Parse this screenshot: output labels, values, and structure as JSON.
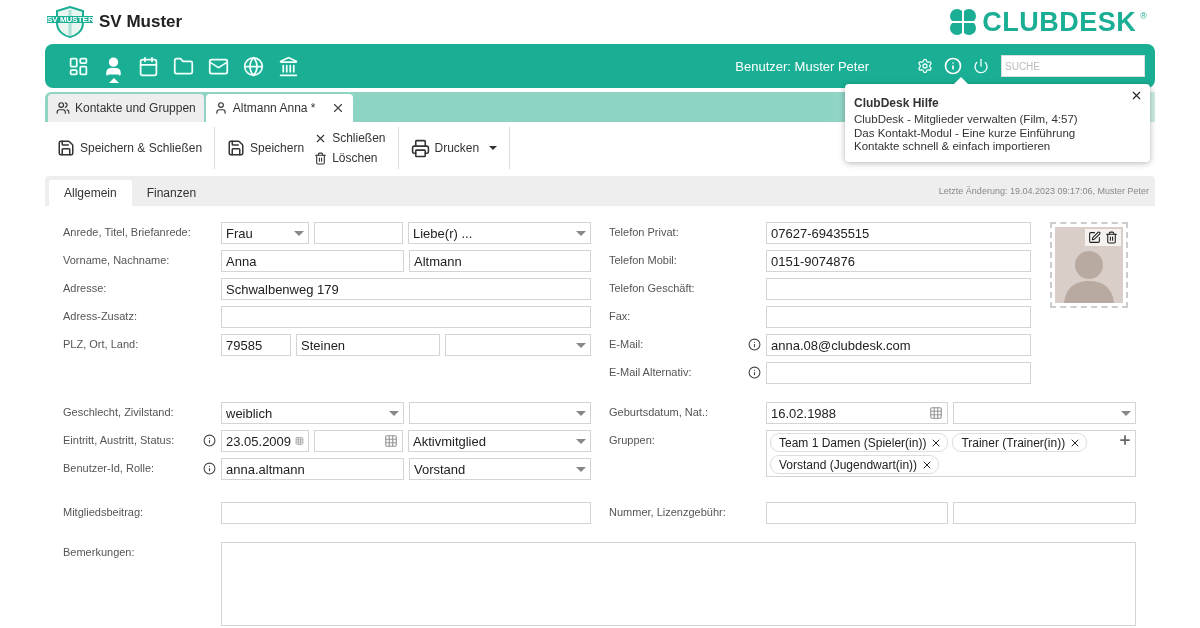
{
  "header": {
    "club_name": "SV Muster",
    "club_badge": "SV MUSTER",
    "brand": "CLUBDESK",
    "brand_mark": "®"
  },
  "nav": {
    "items": [
      {
        "kind": "dashboard",
        "selected": false
      },
      {
        "kind": "person",
        "selected": true
      },
      {
        "kind": "calendar",
        "selected": false
      },
      {
        "kind": "folder",
        "selected": false
      },
      {
        "kind": "mail",
        "selected": false
      },
      {
        "kind": "globe",
        "selected": false
      },
      {
        "kind": "bank",
        "selected": false
      }
    ],
    "user": "Benutzer: Muster Peter",
    "tools": [
      {
        "kind": "settings",
        "selected": false
      },
      {
        "kind": "info",
        "selected": true
      },
      {
        "kind": "power",
        "selected": false
      }
    ],
    "search": {
      "placeholder": "SUCHE"
    }
  },
  "doc_tabs": [
    {
      "kind": "group",
      "label": "Kontakte und Gruppen",
      "selected": false,
      "closable": false
    },
    {
      "kind": "person",
      "label": "Altmann Anna *",
      "selected": true,
      "closable": true
    }
  ],
  "toolbar": [
    {
      "buttons": [
        {
          "kind": "save",
          "label": "Speichern & Schließen"
        }
      ]
    },
    {
      "buttons": [
        {
          "kind": "save",
          "label": "Speichern"
        }
      ],
      "stack": [
        {
          "kind": "close",
          "label": "Schließen"
        },
        {
          "kind": "trash",
          "label": "Löschen"
        }
      ]
    },
    {
      "buttons": [
        {
          "kind": "print",
          "label": "Drucken",
          "dropdown": true
        }
      ]
    }
  ],
  "form_tabs": [
    {
      "label": "Allgemein",
      "selected": true
    },
    {
      "label": "Finanzen",
      "selected": false
    }
  ],
  "last_change": "Letzte Änderung: 19.04.2023 09:17:06, Muster Peter",
  "form": {
    "contact": {
      "left": [
        {
          "label": "Anrede, Titel, Briefanrede:",
          "info": false,
          "fields": [
            {
              "kind": "select",
              "value": "Frau"
            },
            {
              "kind": "text"
            },
            {
              "kind": "select",
              "value": "Liebe(r) ..."
            }
          ]
        },
        {
          "label": "Vorname, Nachname:",
          "info": false,
          "fields": [
            {
              "kind": "text",
              "value": "Anna"
            },
            {
              "kind": "text",
              "value": "Altmann"
            }
          ]
        },
        {
          "label": "Adresse:",
          "info": false,
          "fields": [
            {
              "kind": "text",
              "value": "Schwalbenweg 179"
            }
          ]
        },
        {
          "label": "Adress-Zusatz:",
          "info": false,
          "fields": [
            {
              "kind": "text"
            }
          ]
        },
        {
          "label": "PLZ, Ort, Land:",
          "info": false,
          "fields": [
            {
              "kind": "text",
              "value": "79585"
            },
            {
              "kind": "text",
              "value": "Steinen"
            },
            {
              "kind": "select"
            }
          ]
        }
      ],
      "right": [
        {
          "label": "Telefon Privat:",
          "info": false,
          "fields": [
            {
              "kind": "text",
              "value": "07627-69435515"
            }
          ]
        },
        {
          "label": "Telefon Mobil:",
          "info": false,
          "fields": [
            {
              "kind": "text",
              "value": "0151-9074876"
            }
          ]
        },
        {
          "label": "Telefon Geschäft:",
          "info": false,
          "fields": [
            {
              "kind": "text"
            }
          ]
        },
        {
          "label": "Fax:",
          "info": false,
          "fields": [
            {
              "kind": "text"
            }
          ]
        },
        {
          "label": "E-Mail:",
          "info": true,
          "fields": [
            {
              "kind": "text",
              "value": "anna.08@clubdesk.com"
            }
          ]
        },
        {
          "label": "E-Mail Alternativ:",
          "info": true,
          "fields": [
            {
              "kind": "text"
            }
          ]
        }
      ]
    },
    "membership": {
      "left": [
        {
          "label": "Geschlecht, Zivilstand:",
          "info": false,
          "fields": [
            {
              "kind": "select",
              "value": "weiblich"
            },
            {
              "kind": "select"
            }
          ]
        },
        {
          "label": "Eintritt, Austritt, Status:",
          "info": true,
          "fields": [
            {
              "kind": "date",
              "value": "23.05.2009"
            },
            {
              "kind": "date"
            },
            {
              "kind": "select",
              "value": "Aktivmitglied"
            }
          ]
        },
        {
          "label": "Benutzer-Id, Rolle:",
          "info": true,
          "fields": [
            {
              "kind": "text",
              "value": "anna.altmann"
            },
            {
              "kind": "select",
              "value": "Vorstand"
            }
          ]
        }
      ],
      "right": [
        {
          "label": "Geburtsdatum, Nat.:",
          "info": false,
          "fields": [
            {
              "kind": "date",
              "value": "16.02.1988"
            },
            {
              "kind": "select"
            }
          ]
        },
        {
          "label": "Gruppen:",
          "info": false,
          "fields": [
            {
              "kind": "chips",
              "chips": [
                "Team 1 Damen (Spieler(in))",
                "Trainer (Trainer(in))",
                "Vorstand (Jugendwart(in))"
              ]
            }
          ]
        }
      ]
    },
    "fees": {
      "left": [
        {
          "label": "Mitgliedsbeitrag:",
          "info": false,
          "fields": [
            {
              "kind": "text"
            }
          ]
        }
      ],
      "right": [
        {
          "label": "Nummer, Lizenzgebühr:",
          "info": false,
          "fields": [
            {
              "kind": "text"
            },
            {
              "kind": "text"
            }
          ]
        }
      ]
    },
    "remarks": {
      "label": "Bemerkungen:"
    }
  },
  "help_popup": {
    "title": "ClubDesk Hilfe",
    "links": [
      "ClubDesk - Mitglieder verwalten (Film, 4:57)",
      "Das Kontakt-Modul - Eine kurze Einführung",
      "Kontakte schnell & einfach importieren"
    ]
  }
}
